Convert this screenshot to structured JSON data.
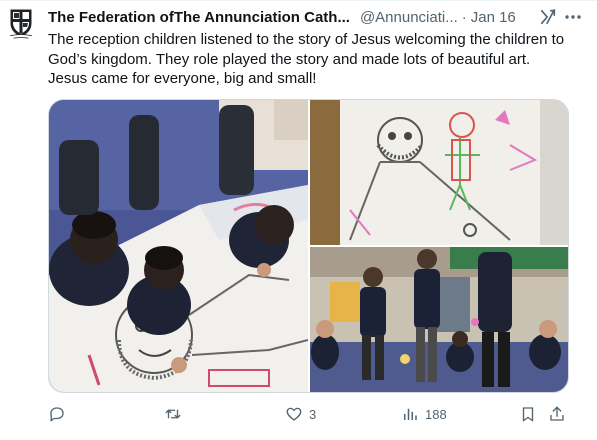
{
  "tweet": {
    "display_name": "The Federation ofThe Annunciation Cath...",
    "handle": "@Annunciati...",
    "separator": "·",
    "date": "Jan 16",
    "text": "The reception children listened to the story of Jesus welcoming the children to\nGod’s kingdom. They role played the story and made lots of beautiful art.\nJesus came for everyone, big and small!",
    "avatar_icon": "school-crest-icon",
    "photos": [
      {
        "name": "children-drawing-on-paper-photo",
        "description_icon": "photo-icon"
      },
      {
        "name": "jesus-drawing-photo",
        "description_icon": "photo-icon"
      },
      {
        "name": "classroom-roleplay-photo",
        "description_icon": "photo-icon"
      }
    ]
  },
  "actions": {
    "reply": {
      "icon": "reply-icon",
      "count": ""
    },
    "retweet": {
      "icon": "retweet-icon",
      "count": ""
    },
    "like": {
      "icon": "heart-icon",
      "count": "3"
    },
    "views": {
      "icon": "views-icon",
      "count": "188"
    },
    "bookmark": {
      "icon": "bookmark-icon"
    },
    "share": {
      "icon": "share-icon"
    }
  },
  "colors": {
    "text": "#0f1419",
    "secondary": "#536471",
    "border": "#cfd9de"
  }
}
